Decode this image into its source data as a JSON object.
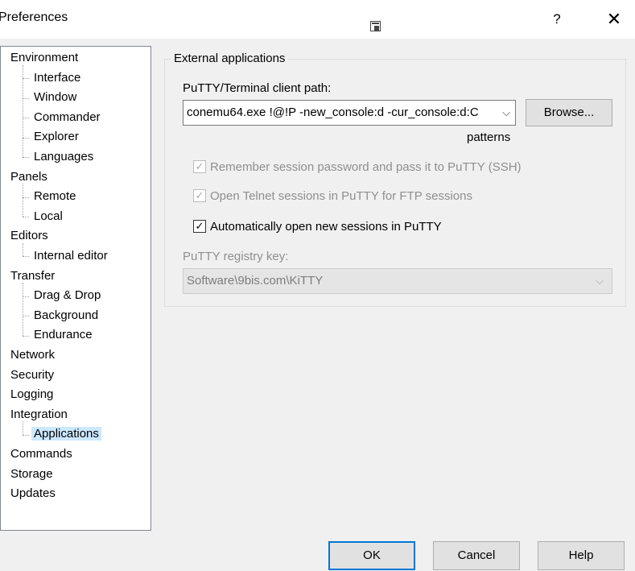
{
  "window": {
    "title": "Preferences",
    "help_glyph": "?",
    "close_glyph": "✕"
  },
  "tree": [
    {
      "label": "Environment",
      "level": 0
    },
    {
      "label": "Interface",
      "level": 1
    },
    {
      "label": "Window",
      "level": 1
    },
    {
      "label": "Commander",
      "level": 1
    },
    {
      "label": "Explorer",
      "level": 1
    },
    {
      "label": "Languages",
      "level": 1
    },
    {
      "label": "Panels",
      "level": 0
    },
    {
      "label": "Remote",
      "level": 1
    },
    {
      "label": "Local",
      "level": 1
    },
    {
      "label": "Editors",
      "level": 0
    },
    {
      "label": "Internal editor",
      "level": 1
    },
    {
      "label": "Transfer",
      "level": 0
    },
    {
      "label": "Drag & Drop",
      "level": 1
    },
    {
      "label": "Background",
      "level": 1
    },
    {
      "label": "Endurance",
      "level": 1
    },
    {
      "label": "Network",
      "level": 0
    },
    {
      "label": "Security",
      "level": 0
    },
    {
      "label": "Logging",
      "level": 0
    },
    {
      "label": "Integration",
      "level": 0
    },
    {
      "label": "Applications",
      "level": 1,
      "selected": true
    },
    {
      "label": "Commands",
      "level": 0
    },
    {
      "label": "Storage",
      "level": 0
    },
    {
      "label": "Updates",
      "level": 0
    }
  ],
  "external": {
    "group_title": "External applications",
    "path_label": "PuTTY/Terminal client path:",
    "path_value": "conemu64.exe !@!P -new_console:d -cur_console:d:C",
    "browse_label": "Browse...",
    "patterns_label": "patterns",
    "remember_password": {
      "label": "Remember session password and pass it to PuTTY (SSH)",
      "checked": true,
      "enabled": false
    },
    "telnet": {
      "label": "Open Telnet sessions in PuTTY for FTP sessions",
      "checked": true,
      "enabled": false
    },
    "auto_open": {
      "label": "Automatically open new sessions in PuTTY",
      "checked": true,
      "enabled": true
    },
    "registry_label": "PuTTY registry key:",
    "registry_value": "Software\\9bis.com\\KiTTY"
  },
  "buttons": {
    "ok": "OK",
    "cancel": "Cancel",
    "help": "Help"
  },
  "icons": {
    "check": "✓",
    "dropdown": "⌵"
  },
  "colors": {
    "selection": "#cce8ff",
    "default_button_border": "#0078d7"
  }
}
